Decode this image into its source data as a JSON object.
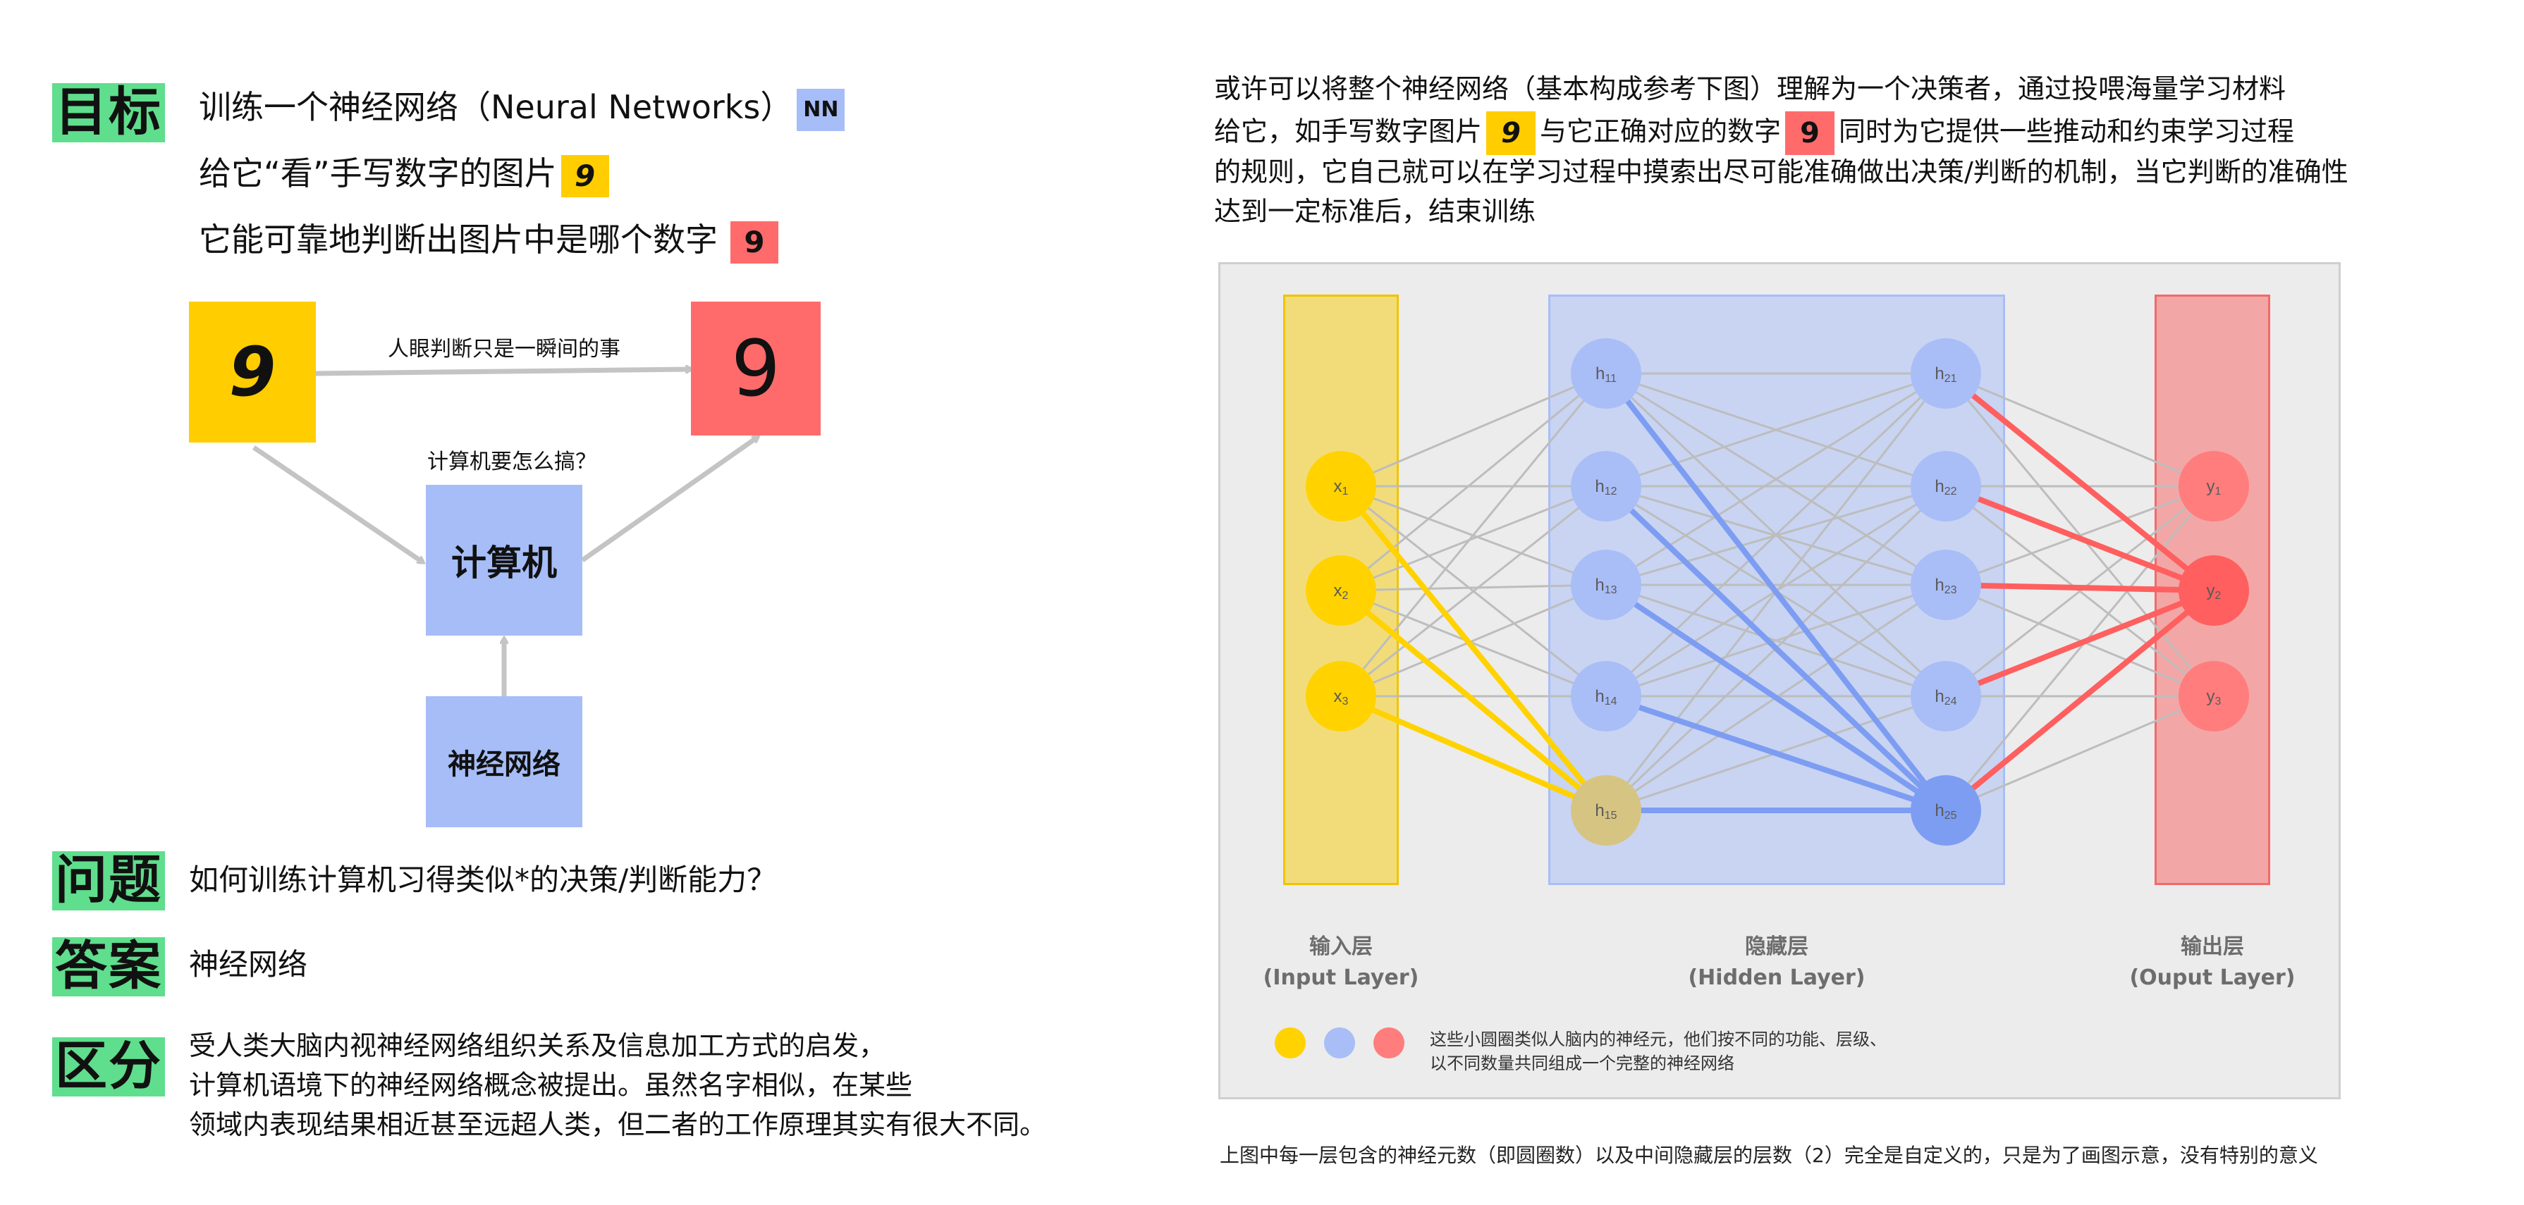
{
  "left": {
    "goal": {
      "tag": "目标",
      "line1": "训练一个神经网络（Neural Networks）",
      "nn_chip": "NN",
      "line2": "给它“看”手写数字的图片",
      "hand_chip": "9",
      "line3": "它能可靠地判断出图片中是哪个数字",
      "digit_chip": "9"
    },
    "flow": {
      "input_digit": "9",
      "output_digit": "9",
      "eye_label": "人眼判断只是一瞬间的事",
      "question_label": "计算机要怎么搞？",
      "computer": "计算机",
      "nn_box": "神经网络",
      "colors": {
        "yellow": "#ffcd00",
        "red": "#ff6b6b",
        "blue": "#a6bdf7",
        "arrow": "#c4c4c4"
      }
    },
    "question": {
      "tag": "问题",
      "text": "如何训练计算机习得类似*的决策/判断能力？"
    },
    "answer": {
      "tag": "答案",
      "text": "神经网络"
    },
    "diff": {
      "tag": "区分",
      "lines": [
        "受人类大脑内视神经网络组织关系及信息加工方式的启发，",
        "计算机语境下的神经网络概念被提出。虽然名字相似，在某些",
        "领域内表现结果相近甚至远超人类，但二者的工作原理其实有很大不同。"
      ]
    }
  },
  "right": {
    "intro": {
      "line1": "或许可以将整个神经网络（基本构成参考下图）理解为一个决策者，通过投喂海量学习材料",
      "line2a": "给它，如手写数字图片",
      "chip_hand": "9",
      "line2b": "与它正确对应的数字",
      "chip_digit": "9",
      "line2c": "同时为它提供一些推动和约束学习过程",
      "line3": "的规则，它自己就可以在学习过程中摸索出尽可能准确做出决策/判断的机制，当它判断的准确性",
      "line4": "达到一定标准后，结束训练"
    },
    "network": {
      "input_nodes": [
        "x",
        "x",
        "x"
      ],
      "input_subs": [
        "1",
        "2",
        "3"
      ],
      "hidden1_subs": [
        "11",
        "12",
        "13",
        "14",
        "15"
      ],
      "hidden2_subs": [
        "21",
        "22",
        "23",
        "24",
        "25"
      ],
      "output_subs": [
        "1",
        "2",
        "3"
      ],
      "hidden_letter": "h",
      "output_letter": "y",
      "input_label": "输入层",
      "input_label_en": "(Input Layer)",
      "hidden_label": "隐藏层",
      "hidden_label_en": "(Hidden Layer)",
      "output_label": "输出层",
      "output_label_en": "(Ouput Layer)",
      "legend_line1": "这些小圆圈类似人脑内的神经元，他们按不同的功能、层级、",
      "legend_line2": "以不同数量共同组成一个完整的神经网络",
      "colors": {
        "panel_bg": "#ececec",
        "input_col": "#f2dc7a",
        "input_node": "#ffd200",
        "hidden_col": "#c8d4f2",
        "hidden_node": "#a9bdf7",
        "hidden_dark": "#7d9df2",
        "hidden_tan": "#d6c482",
        "output_col": "#f3a6a6",
        "output_node": "#ff7d7d",
        "output_dark": "#ff5f5f",
        "edge": "#bdbdbd"
      }
    },
    "caption": "上图中每一层包含的神经元数（即圆圈数）以及中间隐藏层的层数（2）完全是自定义的，只是为了画图示意，没有特别的意义"
  }
}
